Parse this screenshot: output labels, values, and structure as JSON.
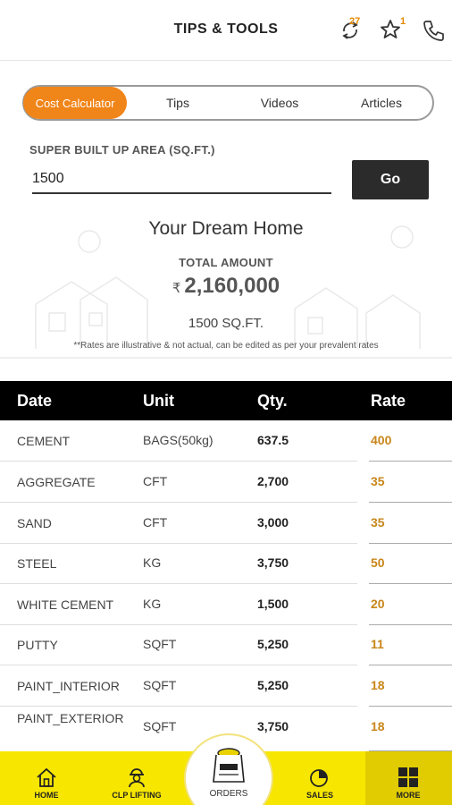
{
  "header": {
    "title": "TIPS & TOOLS",
    "refresh_badge": "27",
    "star_badge": "1"
  },
  "tabs": [
    {
      "label": "Cost Calculator",
      "active": true
    },
    {
      "label": "Tips",
      "active": false
    },
    {
      "label": "Videos",
      "active": false
    },
    {
      "label": "Articles",
      "active": false
    }
  ],
  "area": {
    "label": "SUPER BUILT UP AREA (SQ.FT.)",
    "value": "1500",
    "go_label": "Go"
  },
  "summary": {
    "title": "Your Dream Home",
    "total_label": "TOTAL AMOUNT",
    "currency": "₹",
    "total_amount": "2,160,000",
    "sqft": "1500 SQ.FT.",
    "note": "**Rates are illustrative & not actual, can be edited as per your prevalent rates"
  },
  "table": {
    "headers": [
      "Date",
      "Unit",
      "Qty.",
      "Rate"
    ],
    "rows": [
      {
        "item": "CEMENT",
        "unit": "BAGS(50kg)",
        "qty": "637.5",
        "rate": "400"
      },
      {
        "item": "AGGREGATE",
        "unit": "CFT",
        "qty": "2,700",
        "rate": "35"
      },
      {
        "item": "SAND",
        "unit": "CFT",
        "qty": "3,000",
        "rate": "35"
      },
      {
        "item": "STEEL",
        "unit": "KG",
        "qty": "3,750",
        "rate": "50"
      },
      {
        "item": "WHITE CEMENT",
        "unit": "KG",
        "qty": "1,500",
        "rate": "20"
      },
      {
        "item": "PUTTY",
        "unit": "SQFT",
        "qty": "5,250",
        "rate": "11"
      },
      {
        "item": "PAINT_INTERIOR",
        "unit": "SQFT",
        "qty": "5,250",
        "rate": "18"
      },
      {
        "item": "PAINT_EXTERIOR",
        "unit": "SQFT",
        "qty": "3,750",
        "rate": "18"
      }
    ]
  },
  "bottom_nav": {
    "home": "HOME",
    "clp_lifting": "CLP LIFTING",
    "orders": "ORDERS",
    "sales": "SALES",
    "more": "MORE"
  },
  "colors": {
    "accent": "#f08519",
    "nav_bg": "#f7e600",
    "rate_text": "#c8861a"
  }
}
